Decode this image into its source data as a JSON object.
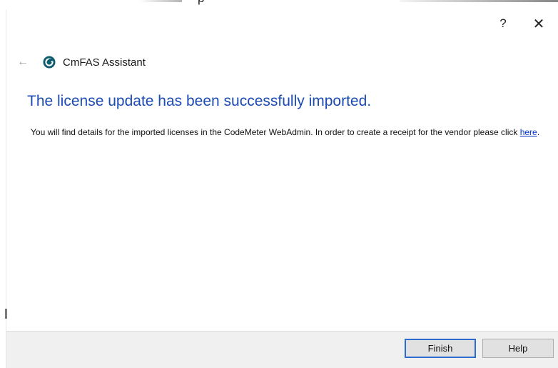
{
  "window": {
    "help_glyph": "?",
    "close_glyph": "✕",
    "top_strip_text": "p"
  },
  "header": {
    "back_glyph": "←",
    "app_title": "CmFAS Assistant",
    "logo_icon": "codemeter-logo-icon"
  },
  "main": {
    "heading": "The license update has been successfully imported.",
    "text_before_link": "You will find details for the imported licenses in the CodeMeter WebAdmin. In order to create a receipt for the vendor please click ",
    "link_text": "here",
    "text_after_link": "."
  },
  "footer": {
    "finish_label": "Finish",
    "help_label": "Help"
  },
  "colors": {
    "heading": "#1b4bb3",
    "link": "#0033cc",
    "footer_bg": "#f0f0f0",
    "primary_border": "#2d6bd1"
  }
}
